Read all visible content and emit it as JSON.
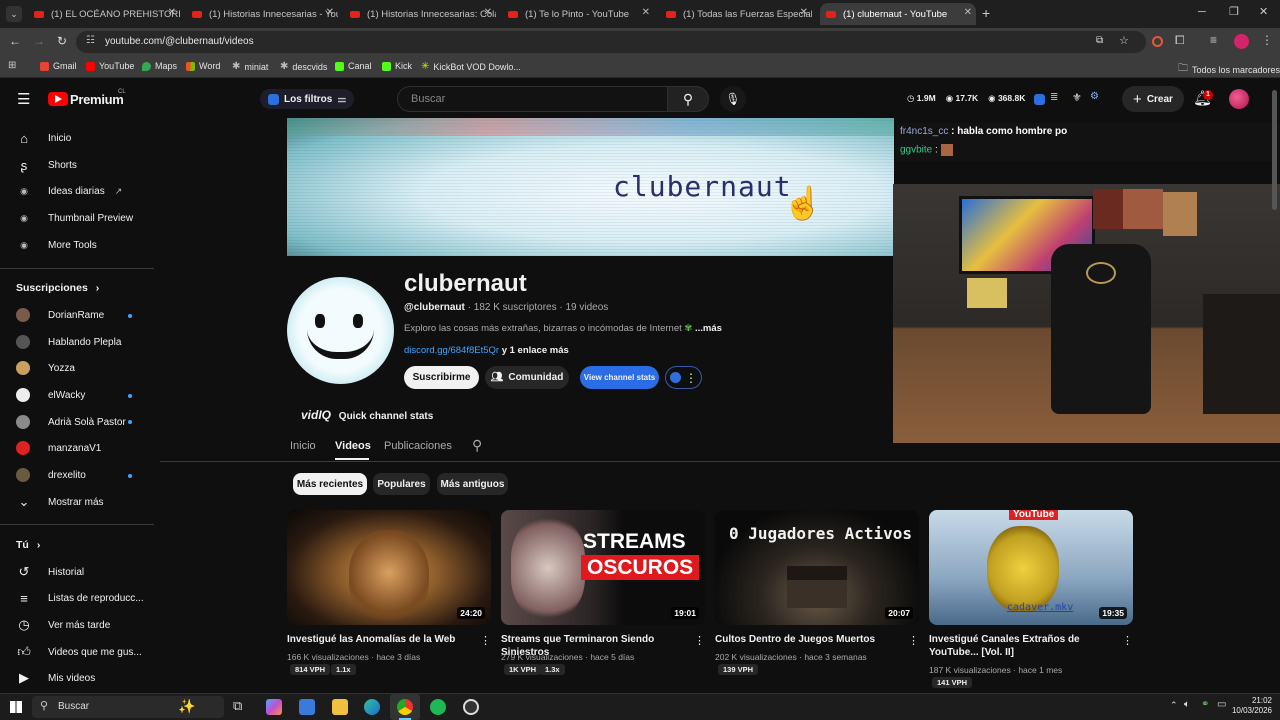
{
  "browser": {
    "tabs": [
      {
        "label": "(1) EL OCÉANO PREHISTORICO"
      },
      {
        "label": "(1) Historias Innecesarias - YouT"
      },
      {
        "label": "(1) Historias Innecesarias: Colap"
      },
      {
        "label": "(1) Te lo Pinto - YouTube"
      },
      {
        "label": "(1) Todas las Fuerzas Especiales"
      },
      {
        "label": "(1) clubernaut - YouTube"
      }
    ],
    "url": "youtube.com/@clubernaut/videos",
    "bookmarks": [
      "Gmail",
      "YouTube",
      "Maps",
      "Word",
      "miniat",
      "descvids",
      "Canal",
      "Kick",
      "KickBot VOD Dowlo..."
    ],
    "all_bookmarks": "Todos los marcadores"
  },
  "header": {
    "logo": "Premium",
    "region": "CL",
    "filters": "Los filtros",
    "search_placeholder": "Buscar",
    "stat1": "1.9M",
    "stat2": "17.7K",
    "stat3": "368.8K",
    "create": "Crear",
    "notif_count": "1"
  },
  "sidebar": {
    "main": [
      {
        "label": "Inicio",
        "icon": "home-icon"
      },
      {
        "label": "Shorts",
        "icon": "shorts-icon"
      },
      {
        "label": "Ideas diarias",
        "icon": "vidiq-icon"
      },
      {
        "label": "Thumbnail Preview",
        "icon": "vidiq-icon"
      },
      {
        "label": "More Tools",
        "icon": "vidiq-icon"
      }
    ],
    "subs_title": "Suscripciones",
    "subs": [
      {
        "label": "DorianRame",
        "color": "#7a5a4a"
      },
      {
        "label": "Hablando Plepla",
        "color": "#555"
      },
      {
        "label": "Yozza",
        "color": "#c9a060"
      },
      {
        "label": "elWacky",
        "color": "#eee"
      },
      {
        "label": "Adrià Solà Pastor",
        "color": "#8a8a8a"
      },
      {
        "label": "manzanaV1",
        "color": "#d22"
      },
      {
        "label": "drexelito",
        "color": "#6a5a40"
      }
    ],
    "show_more": "Mostrar más",
    "you_title": "Tú",
    "you": [
      {
        "label": "Historial"
      },
      {
        "label": "Listas de reproducc..."
      },
      {
        "label": "Ver más tarde"
      },
      {
        "label": "Videos que me gus..."
      },
      {
        "label": "Mis videos"
      }
    ]
  },
  "channel": {
    "banner_text": "clubernaut",
    "name": "clubernaut",
    "handle": "@clubernaut",
    "subscribers": "182 K suscriptores",
    "videos_count": "19 videos",
    "description": "Exploro las cosas más extrañas, bizarras o incómodas de Internet",
    "more": "...más",
    "link": "discord.gg/684f8Et5Qr",
    "link_more": "y 1 enlace más",
    "subscribe": "Suscribirme",
    "community": "Comunidad",
    "view_stats": "View channel stats",
    "vidiq": "vidIQ",
    "quick_stats": "Quick channel stats"
  },
  "tabs": [
    "Inicio",
    "Videos",
    "Publicaciones"
  ],
  "chips": [
    "Más recientes",
    "Populares",
    "Más antiguos"
  ],
  "chat": {
    "msg1_user": "fr4nc1s_cc",
    "msg1_text": ": habla como hombre po",
    "msg2_user": "ggvbite",
    "msg2_text": ":"
  },
  "videos": [
    {
      "title": "Investigué las Anomalías de la Web",
      "views": "166 K visualizaciones",
      "age": "hace 3 días",
      "duration": "24:20",
      "vph": "814 VPH",
      "mult": "1.1x"
    },
    {
      "title": "Streams que Terminaron Siendo Siniestros",
      "views": "279 K visualizaciones",
      "age": "hace 5 días",
      "duration": "19:01",
      "vph": "1K VPH",
      "mult": "1.3x",
      "thumb_text1": "STREAMS",
      "thumb_text2": "OSCUROS"
    },
    {
      "title": "Cultos Dentro de Juegos Muertos",
      "views": "202 K visualizaciones",
      "age": "hace 3 semanas",
      "duration": "20:07",
      "vph": "139 VPH",
      "thumb_text1": "0 Jugadores Activos"
    },
    {
      "title": "Investigué Canales Extraños de YouTube... [Vol. II]",
      "views": "187 K visualizaciones",
      "age": "hace 1 mes",
      "duration": "19:35",
      "vph": "141 VPH",
      "thumb_text1": "YouTube",
      "thumb_text2": "cadaver.mkv"
    }
  ],
  "taskbar": {
    "search": "Buscar",
    "time": "21:02",
    "date": "10/03/2026"
  }
}
